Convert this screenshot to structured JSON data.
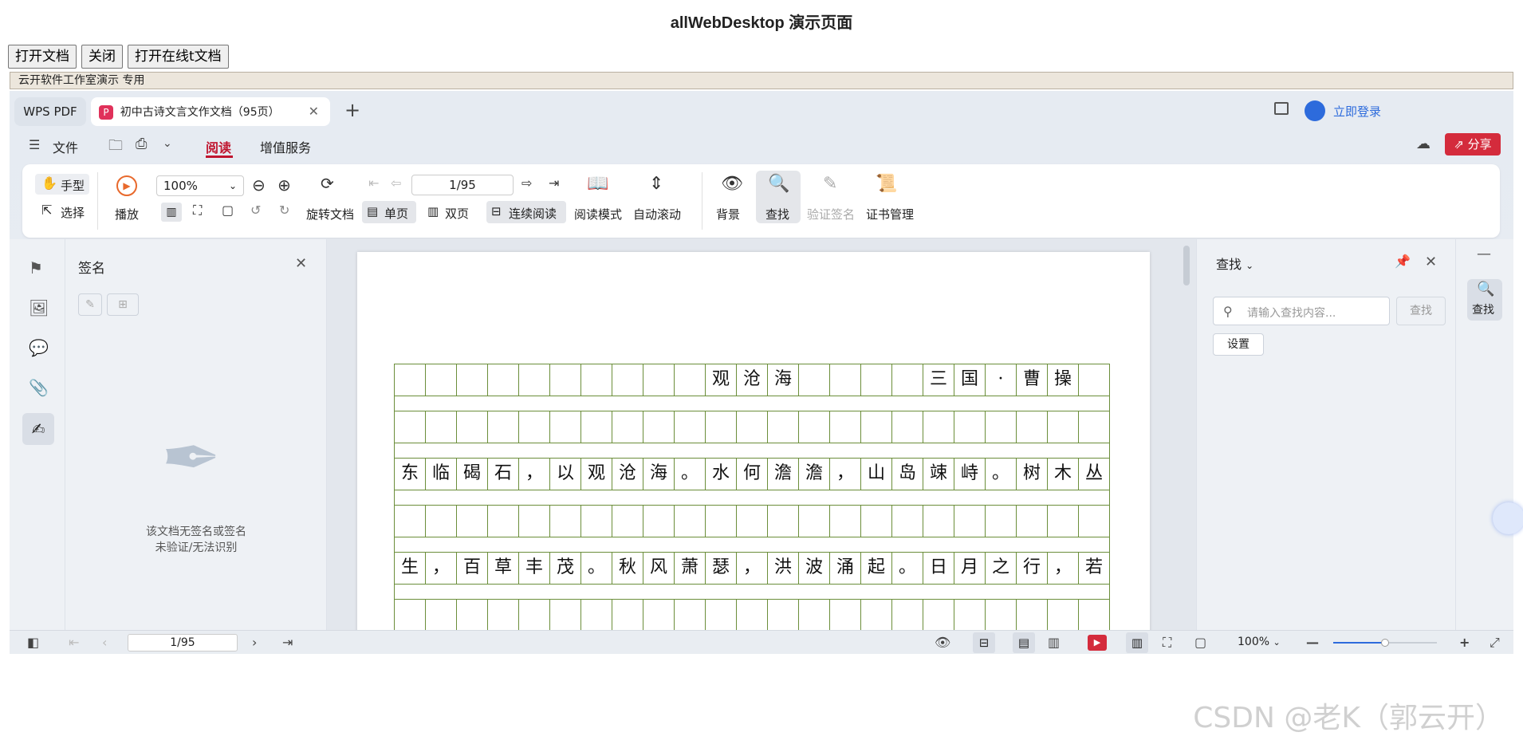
{
  "page": {
    "title": "allWebDesktop 演示页面"
  },
  "top_buttons": {
    "open": "打开文档",
    "close": "关闭",
    "open_online": "打开在线t文档"
  },
  "demo_bar": {
    "text": "云开软件工作室演示  专用"
  },
  "tabs": {
    "wps": "WPS PDF",
    "doc": "初中古诗文言文作文档（95页）",
    "new": "+"
  },
  "account": {
    "login": "立即登录"
  },
  "menu": {
    "file": "文件",
    "read": "阅读",
    "value_added": "增值服务",
    "share": "分享"
  },
  "toolbar": {
    "hand": "手型",
    "select": "选择",
    "play": "播放",
    "zoom": "100%",
    "page": "1/95",
    "rotate": "旋转文档",
    "single": "单页",
    "double": "双页",
    "continuous": "连续阅读",
    "read_mode": "阅读模式",
    "auto_scroll": "自动滚动",
    "background": "背景",
    "find": "查找",
    "verify_sign": "验证签名",
    "cert_manage": "证书管理"
  },
  "sig_panel": {
    "title": "签名",
    "empty_line1": "该文档无签名或签名",
    "empty_line2": "未验证/无法识别"
  },
  "document": {
    "rows": [
      [
        "",
        "",
        "",
        "",
        "",
        "",
        "",
        "",
        "",
        "",
        "观",
        "沧",
        "海",
        "",
        "",
        "",
        "",
        "三",
        "国",
        "·",
        "曹",
        "操",
        ""
      ],
      [
        "",
        "",
        "",
        "",
        "",
        "",
        "",
        "",
        "",
        "",
        "",
        "",
        "",
        "",
        "",
        "",
        "",
        "",
        "",
        "",
        "",
        "",
        ""
      ],
      [
        "东",
        "临",
        "碣",
        "石",
        "，",
        "以",
        "观",
        "沧",
        "海",
        "。",
        "水",
        "何",
        "澹",
        "澹",
        "，",
        "山",
        "岛",
        "竦",
        "峙",
        "。",
        "树",
        "木",
        "丛"
      ],
      [
        "",
        "",
        "",
        "",
        "",
        "",
        "",
        "",
        "",
        "",
        "",
        "",
        "",
        "",
        "",
        "",
        "",
        "",
        "",
        "",
        "",
        "",
        ""
      ],
      [
        "生",
        "，",
        "百",
        "草",
        "丰",
        "茂",
        "。",
        "秋",
        "风",
        "萧",
        "瑟",
        "，",
        "洪",
        "波",
        "涌",
        "起",
        "。",
        "日",
        "月",
        "之",
        "行",
        "，",
        "若"
      ],
      [
        "",
        "",
        "",
        "",
        "",
        "",
        "",
        "",
        "",
        "",
        "",
        "",
        "",
        "",
        "",
        "",
        "",
        "",
        "",
        "",
        "",
        "",
        ""
      ]
    ]
  },
  "find_panel": {
    "title": "查找",
    "placeholder": "请输入查找内容...",
    "button": "查找",
    "settings": "设置"
  },
  "far_right": {
    "find": "查找"
  },
  "statusbar": {
    "page": "1/95",
    "zoom": "100%"
  },
  "watermark": {
    "text": "CSDN @老K（郭云开）"
  }
}
